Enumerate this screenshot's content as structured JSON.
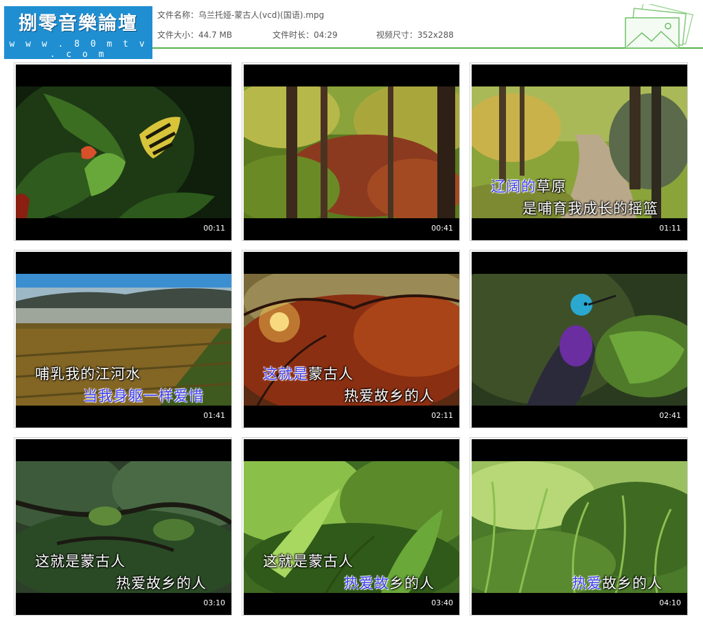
{
  "header": {
    "logo_title": "捌零音樂論壇",
    "logo_url": "w w w . 8 0 m t v . c o m",
    "file_name": "文件名称：乌兰托娅-蒙古人(vcd)(国语).mpg",
    "file_size": "文件大小：44.7 MB",
    "duration": "文件时长：04:29",
    "dimensions": "视频尺寸：352x288"
  },
  "thumbnails": [
    {
      "time": "00:11",
      "scene": "butterfly",
      "line1": {
        "hl": "",
        "rest": ""
      },
      "line2": {
        "hl": "",
        "rest": ""
      }
    },
    {
      "time": "00:41",
      "scene": "autumn-forest",
      "line1": {
        "hl": "",
        "rest": ""
      },
      "line2": {
        "hl": "",
        "rest": ""
      }
    },
    {
      "time": "01:11",
      "scene": "forest-path",
      "line1": {
        "hl": "辽阔的",
        "rest": "草原"
      },
      "line2": {
        "hl": "",
        "rest": "是哺育我成长的摇篮"
      }
    },
    {
      "time": "01:41",
      "scene": "misty-field",
      "line1": {
        "hl": "",
        "rest": "哺乳我的江河水"
      },
      "line2": {
        "hl": "当我身躯一样爱惜",
        "rest": ""
      }
    },
    {
      "time": "02:11",
      "scene": "sunset-branches",
      "line1": {
        "hl": "这就是",
        "rest": "蒙古人"
      },
      "line2": {
        "hl": "",
        "rest": "热爱故乡的人"
      }
    },
    {
      "time": "02:41",
      "scene": "hummingbird",
      "line1": {
        "hl": "",
        "rest": ""
      },
      "line2": {
        "hl": "",
        "rest": ""
      }
    },
    {
      "time": "03:10",
      "scene": "tree-canopy",
      "line1": {
        "hl": "",
        "rest": "这就是蒙古人"
      },
      "line2": {
        "hl": "",
        "rest": "热爱故乡的人"
      }
    },
    {
      "time": "03:40",
      "scene": "green-leaves",
      "line1": {
        "hl": "",
        "rest": "这就是蒙古人"
      },
      "line2": {
        "hl": "热爱故",
        "rest": "乡的人"
      }
    },
    {
      "time": "04:10",
      "scene": "ferns",
      "line1": {
        "hl": "",
        "rest": ""
      },
      "line2": {
        "hl": "热爱",
        "rest": "故乡的人"
      }
    }
  ]
}
